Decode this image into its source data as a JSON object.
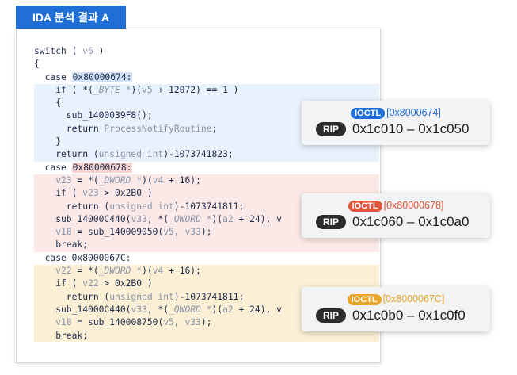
{
  "title": "IDA 분석 결과 A",
  "colors": {
    "title_bg": "#1f6fd6",
    "blue_block": "#e8f1fc",
    "red_block": "#fbe9e7",
    "yellow_block": "#fbf0d6",
    "ioctl_blue": "#1f6fd6",
    "ioctl_red": "#e0553b",
    "ioctl_yellow": "#e9a62b"
  },
  "code": {
    "l1": "switch ( ",
    "l1v": "v6",
    "l1e": " )",
    "l2": "{",
    "case1_kw": "  case ",
    "case1_val": "0x80000674:",
    "b1": [
      {
        "a": "    if ( *(",
        "b": "_BYTE *",
        "c": ")(",
        "d": "v5",
        "e": " + 12072) == 1 )"
      },
      {
        "a": "    {"
      },
      {
        "a": "      sub_1400039F8();"
      },
      {
        "a": "      return ",
        "d": "ProcessNotifyRoutine",
        "e": ";"
      },
      {
        "a": "    }"
      },
      {
        "a": "    return (",
        "b": "unsigned int",
        "e": ")-1073741823;"
      }
    ],
    "case2_kw": "  case ",
    "case2_val": "0x80000678:",
    "b2": [
      {
        "a": "    ",
        "d": "v23",
        "e": " = *(",
        "b": "_DWORD *",
        "f": ")(",
        "g": "v4",
        "h": " + 16);"
      },
      {
        "a": "    if ( ",
        "d": "v23",
        "e": " > 0x2B0 )"
      },
      {
        "a": "      return (",
        "b": "unsigned int",
        "e": ")-1073741811;"
      },
      {
        "a": "    sub_14000C440(",
        "d": "v33",
        "e": ", *(",
        "b": "_QWORD *",
        "f": ")(",
        "g": "a2",
        "h": " + 24), v"
      },
      {
        "a": "    ",
        "d": "v18",
        "e": " = sub_140009050(",
        "g": "v5",
        "h": ", ",
        "i": "v33",
        "j": ");"
      },
      {
        "a": "    break;"
      }
    ],
    "case3_kw": "  case ",
    "case3_val": "0x8000067C:",
    "b3": [
      {
        "a": "    ",
        "d": "v22",
        "e": " = *(",
        "b": "_DWORD *",
        "f": ")(",
        "g": "v4",
        "h": " + 16);"
      },
      {
        "a": "    if ( ",
        "d": "v22",
        "e": " > 0x2B0 )"
      },
      {
        "a": "      return (",
        "b": "unsigned int",
        "e": ")-1073741811;"
      },
      {
        "a": "    sub_14000C440(",
        "d": "v33",
        "e": ", *(",
        "b": "_QWORD *",
        "f": ")(",
        "g": "a2",
        "h": " + 24), v"
      },
      {
        "a": "    ",
        "d": "v18",
        "e": " = sub_140008750(",
        "g": "v5",
        "h": ", ",
        "i": "v33",
        "j": ");"
      },
      {
        "a": "    break;"
      }
    ]
  },
  "callouts": [
    {
      "badge": "IOCTL",
      "code": "[0x8000674]",
      "rip_label": "RIP",
      "range": "0x1c010 – 0x1c050"
    },
    {
      "badge": "IOCTL",
      "code": "[0x80000678]",
      "rip_label": "RIP",
      "range": "0x1c060 – 0x1c0a0"
    },
    {
      "badge": "IOCTL",
      "code": "[0x8000067C]",
      "rip_label": "RIP",
      "range": "0x1c0b0 – 0x1c0f0"
    }
  ]
}
